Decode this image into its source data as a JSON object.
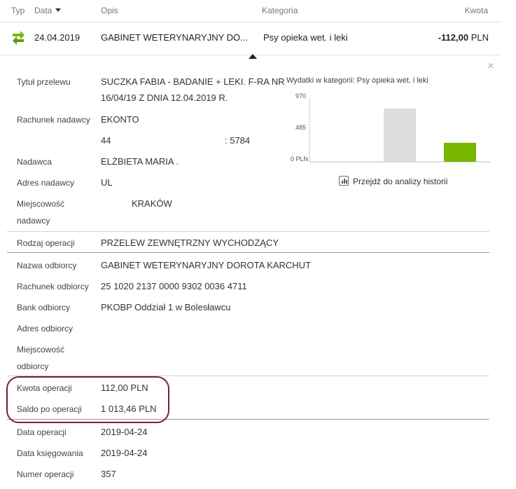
{
  "header": {
    "col_type": "Typ",
    "col_date": "Data",
    "col_desc": "Opis",
    "col_category": "Kategoria",
    "col_amount": "Kwota"
  },
  "transaction": {
    "date": "24.04.2019",
    "description": "GABINET WETERYNARYJNY DO...",
    "category": "Psy opieka wet. i leki",
    "amount": "-112,00",
    "currency": "PLN"
  },
  "details": {
    "title_label": "Tytuł przelewu",
    "title_line1": "SUCZKA FABIA - BADANIE + LEKI. F-RA NR",
    "title_line2": "16/04/19 Z DNIA 12.04.2019 R.",
    "sender_account_label": "Rachunek nadawcy",
    "sender_account_name": "EKONTO",
    "sender_account_prefix": "44",
    "sender_account_suffix": ": 5784",
    "sender_label": "Nadawca",
    "sender_value": "ELŻBIETA MARIA .",
    "sender_address_label": "Adres nadawcy",
    "sender_address_value": "UL",
    "city_label_line1": "Miejscowość",
    "city_label_line2": "nadawcy",
    "city_value": "KRAKÓW",
    "operation_type_label": "Rodzaj operacji",
    "operation_type_value": "PRZELEW ZEWNĘTRZNY WYCHODZĄCY",
    "recipient_name_label": "Nazwa odbiorcy",
    "recipient_name_value": "GABINET WETERYNARYJNY DOROTA KARCHUT",
    "recipient_account_label": "Rachunek odbiorcy",
    "recipient_account_value": "25 1020 2137 0000 9302 0036 4711",
    "recipient_bank_label": "Bank odbiorcy",
    "recipient_bank_value": "PKOBP Oddział 1 w Bolesławcu",
    "recipient_address_label": "Adres odbiorcy",
    "recipient_city_label_line1": "Miejscowość",
    "recipient_city_label_line2": "odbiorcy",
    "operation_amount_label": "Kwota operacji",
    "operation_amount_value": "112,00 PLN",
    "balance_label": "Saldo po operacji",
    "balance_value": "1 013,46 PLN",
    "operation_date_label": "Data operacji",
    "operation_date_value": "2019-04-24",
    "booking_date_label": "Data księgowania",
    "booking_date_value": "2019-04-24",
    "operation_number_label": "Numer operacji",
    "operation_number_value": "357"
  },
  "chart_data": {
    "type": "bar",
    "title": "Wydatki w kategorii:  Psy opieka wet. i leki",
    "yticks": [
      "970",
      "485",
      "0 PLN"
    ],
    "ylim": [
      0,
      970
    ],
    "values": [
      0,
      810,
      290
    ],
    "colors": [
      "#dddddd",
      "#dddddd",
      "#7ab800"
    ]
  },
  "history_link": "Przejdź do analizy historii",
  "colors": {
    "accent_green": "#7ab800",
    "highlight": "#7a1f35"
  }
}
